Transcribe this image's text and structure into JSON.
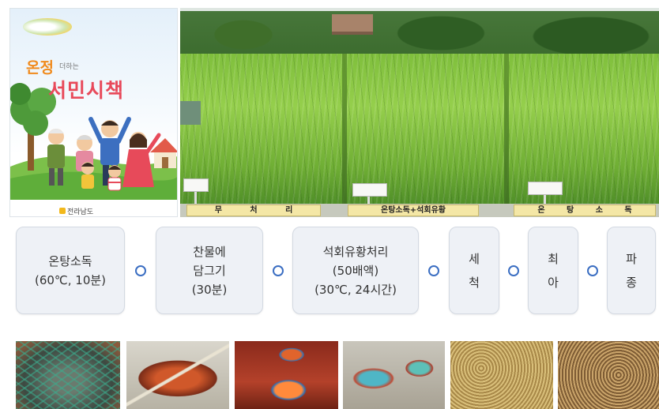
{
  "brochure": {
    "title_a": "온정",
    "title_b": "더하는",
    "title_c": "서민시책",
    "publisher": "전라남도"
  },
  "field_photo": {
    "labels": [
      "무 처 리",
      "온탕소독+석회유황",
      "온 탕 소 독"
    ]
  },
  "process": {
    "steps": [
      {
        "lines": [
          "온탕소독",
          "(60℃, 10분)"
        ]
      },
      {
        "lines": [
          "찬물에",
          "담그기",
          "(30분)"
        ]
      },
      {
        "lines": [
          "석회유황처리",
          "(50배액)",
          "(30℃, 24시간)"
        ]
      },
      {
        "lines": [
          "세",
          "척"
        ]
      },
      {
        "lines": [
          "최",
          "아"
        ]
      },
      {
        "lines": [
          "파",
          "종"
        ]
      }
    ]
  },
  "colors": {
    "flow_connector": "#3b6ec2",
    "step_box_bg": "#eef1f6",
    "field_label_bg": "#f4e7a6",
    "title_orange": "#f08a1c",
    "title_red": "#e8495a"
  }
}
